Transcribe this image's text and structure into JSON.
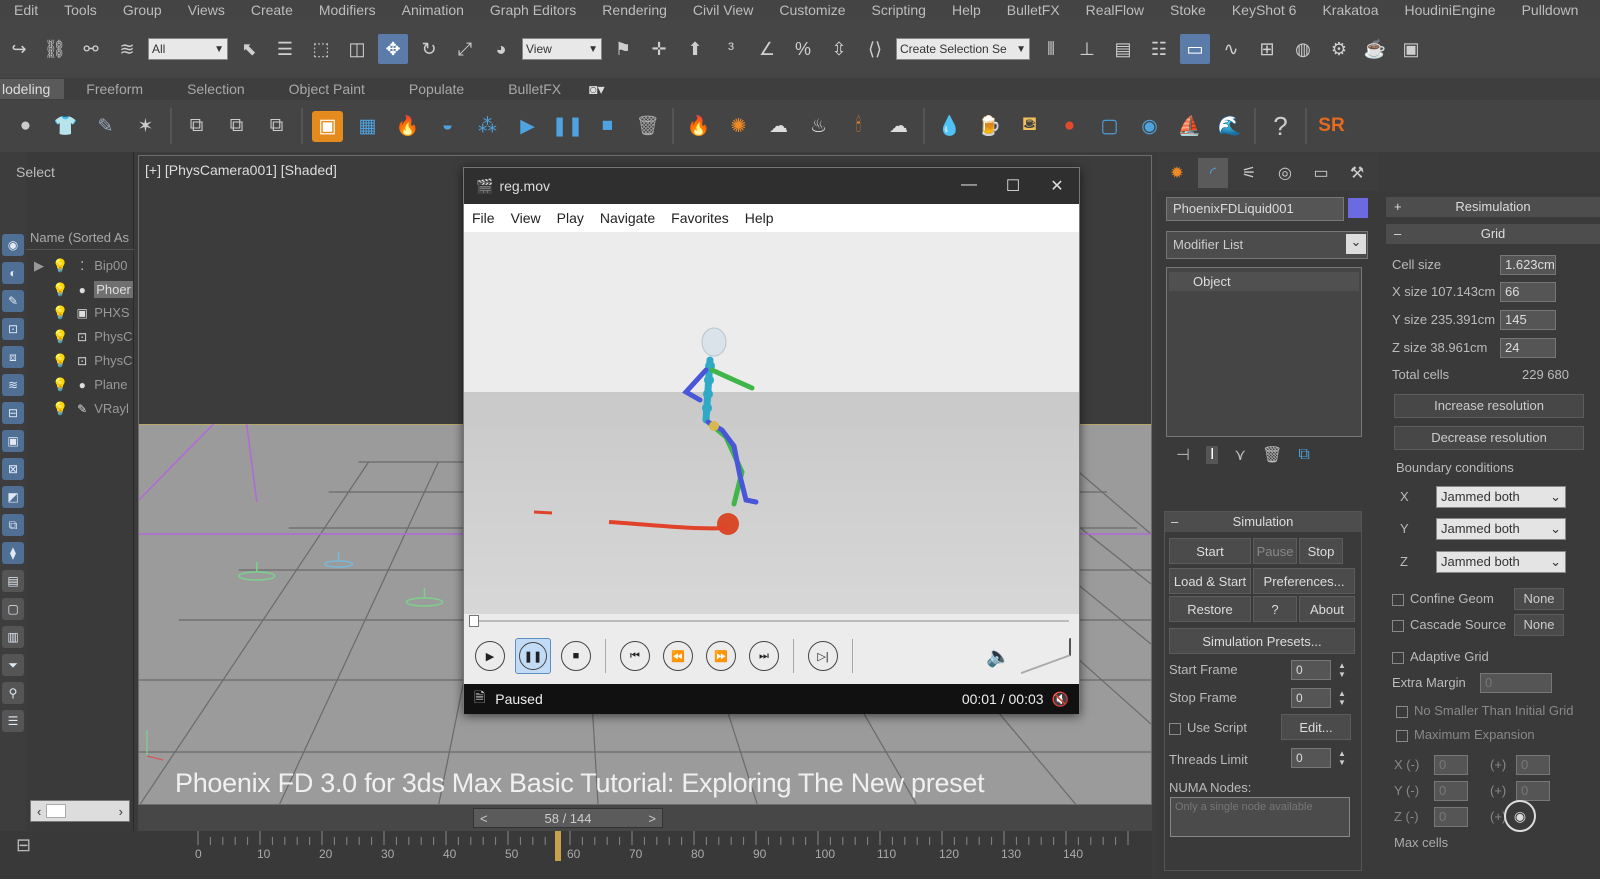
{
  "menubar": [
    "Edit",
    "Tools",
    "Group",
    "Views",
    "Create",
    "Modifiers",
    "Animation",
    "Graph Editors",
    "Rendering",
    "Civil View",
    "Customize",
    "Scripting",
    "Help",
    "BulletFX",
    "RealFlow",
    "Stoke",
    "KeyShot 6",
    "Krakatoa",
    "HoudiniEngine",
    "Pulldown"
  ],
  "toolbar": {
    "filter_value": "All",
    "refcoord_value": "View",
    "selection_set_value": "Create Selection Se"
  },
  "ribbon_tabs": [
    "lodeling",
    "Freeform",
    "Selection",
    "Object Paint",
    "Populate",
    "BulletFX"
  ],
  "ribbon": {
    "sr_label": "SR"
  },
  "explorer": {
    "select_label": "Select",
    "column_header": "Name (Sorted As",
    "rows": [
      "Bip00",
      "Phoer",
      "PHXS",
      "PhysC",
      "PhysC",
      "Plane",
      "VRayl"
    ]
  },
  "viewport": {
    "label": "[+] [PhysCamera001] [Shaded]",
    "subtitle": "Phoenix FD 3.0 for 3ds Max Basic Tutorial: Exploring The New preset"
  },
  "timeline": {
    "frame_readout": "58 / 144",
    "prev": "<",
    "next": ">",
    "ticks": [
      "0",
      "10",
      "20",
      "30",
      "40",
      "50",
      "60",
      "70",
      "80",
      "90",
      "100",
      "110",
      "120",
      "130",
      "140"
    ],
    "current_frame": 58
  },
  "player": {
    "title": "reg.mov",
    "menu": [
      "File",
      "View",
      "Play",
      "Navigate",
      "Favorites",
      "Help"
    ],
    "status": "Paused",
    "time": "00:01 / 00:03"
  },
  "command_panel": {
    "object_name": "PhoenixFDLiquid001",
    "object_color": "#6c6ae0",
    "modifier_list": "Modifier List",
    "stack_item": "Object",
    "simulation_title": "Simulation",
    "start": "Start",
    "pause": "Pause",
    "stop": "Stop",
    "load_start": "Load & Start",
    "preferences": "Preferences...",
    "restore": "Restore",
    "question": "?",
    "about": "About",
    "presets": "Simulation Presets...",
    "start_frame_label": "Start Frame",
    "start_frame_value": "0",
    "stop_frame_label": "Stop Frame",
    "stop_frame_value": "0",
    "use_script_label": "Use Script",
    "edit_label": "Edit...",
    "threads_label": "Threads Limit",
    "threads_value": "0",
    "numa_label": "NUMA Nodes:",
    "numa_value": "Only a single node available"
  },
  "phoenix_panel": {
    "resimulation": "Resimulation",
    "grid": "Grid",
    "cell_size_label": "Cell size",
    "cell_size_value": "1.623cm",
    "x_size_label": "X size 107.143cm",
    "x_size_value": "66",
    "y_size_label": "Y size 235.391cm",
    "y_size_value": "145",
    "z_size_label": "Z size 38.961cm",
    "z_size_value": "24",
    "total_cells_label": "Total cells",
    "total_cells_value": "229 680",
    "increase": "Increase resolution",
    "decrease": "Decrease resolution",
    "boundary_label": "Boundary conditions",
    "bx_label": "X",
    "by_label": "Y",
    "bz_label": "Z",
    "bx_value": "Jammed both",
    "by_value": "Jammed both",
    "bz_value": "Jammed both",
    "confine_label": "Confine Geom",
    "confine_value": "None",
    "cascade_label": "Cascade Source",
    "cascade_value": "None",
    "adaptive_label": "Adaptive Grid",
    "extra_margin_label": "Extra Margin",
    "extra_margin_value": "0",
    "no_smaller_label": "No Smaller Than Initial Grid",
    "max_exp_label": "Maximum Expansion",
    "xm_label": "X (-)",
    "ym_label": "Y (-)",
    "zm_label": "Z (-)",
    "xp_label": "(+)",
    "yp_label": "(+)",
    "zp_label": "(+)",
    "xm_value": "0",
    "ym_value": "0",
    "zm_value": "0",
    "xp_value": "0",
    "yp_value": "0",
    "max_cells_label": "Max cells"
  }
}
